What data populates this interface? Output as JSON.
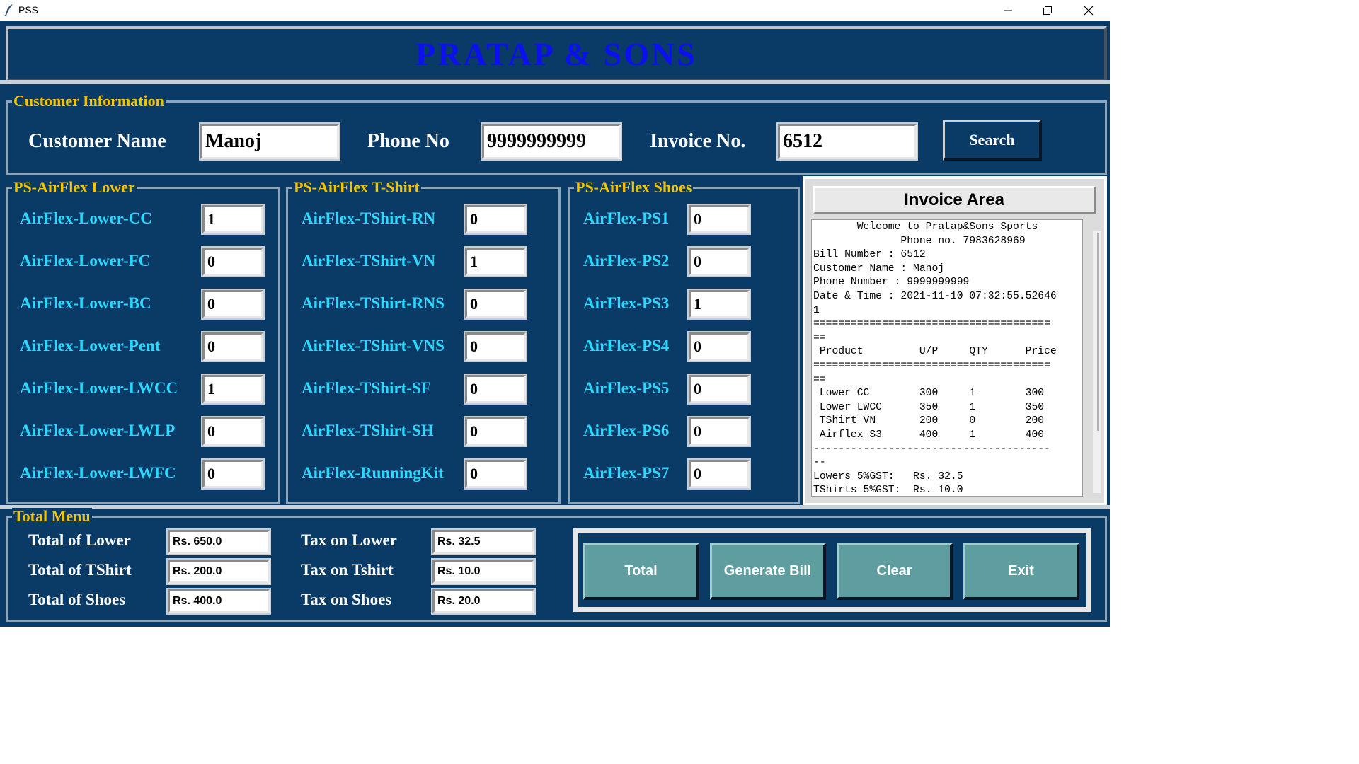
{
  "window": {
    "title": "PSS"
  },
  "header": {
    "title": "Pratap & Sons"
  },
  "customer": {
    "group_title": "Customer Information",
    "name_label": "Customer Name",
    "name_value": "Manoj",
    "phone_label": "Phone No",
    "phone_value": "9999999999",
    "invoice_label": "Invoice No.",
    "invoice_value": "6512",
    "search_label": "Search"
  },
  "lower": {
    "group_title": "PS-AirFlex Lower",
    "items": [
      {
        "label": "AirFlex-Lower-CC",
        "qty": "1"
      },
      {
        "label": "AirFlex-Lower-FC",
        "qty": "0"
      },
      {
        "label": "AirFlex-Lower-BC",
        "qty": "0"
      },
      {
        "label": "AirFlex-Lower-Pent",
        "qty": "0"
      },
      {
        "label": "AirFlex-Lower-LWCC",
        "qty": "1"
      },
      {
        "label": "AirFlex-Lower-LWLP",
        "qty": "0"
      },
      {
        "label": "AirFlex-Lower-LWFC",
        "qty": "0"
      }
    ]
  },
  "tshirt": {
    "group_title": "PS-AirFlex T-Shirt",
    "items": [
      {
        "label": "AirFlex-TShirt-RN",
        "qty": "0"
      },
      {
        "label": "AirFlex-TShirt-VN",
        "qty": "1"
      },
      {
        "label": "AirFlex-TShirt-RNS",
        "qty": "0"
      },
      {
        "label": "AirFlex-TShirt-VNS",
        "qty": "0"
      },
      {
        "label": "AirFlex-TShirt-SF",
        "qty": "0"
      },
      {
        "label": "AirFlex-TShirt-SH",
        "qty": "0"
      },
      {
        "label": "AirFlex-RunningKit",
        "qty": "0"
      }
    ]
  },
  "shoes": {
    "group_title": "PS-AirFlex Shoes",
    "items": [
      {
        "label": "AirFlex-PS1",
        "qty": "0"
      },
      {
        "label": "AirFlex-PS2",
        "qty": "0"
      },
      {
        "label": "AirFlex-PS3",
        "qty": "1"
      },
      {
        "label": "AirFlex-PS4",
        "qty": "0"
      },
      {
        "label": "AirFlex-PS5",
        "qty": "0"
      },
      {
        "label": "AirFlex-PS6",
        "qty": "0"
      },
      {
        "label": "AirFlex-PS7",
        "qty": "0"
      }
    ]
  },
  "invoice": {
    "title": "Invoice Area",
    "lines": [
      "       Welcome to Pratap&Sons Sports",
      "              Phone no. 7983628969",
      "Bill Number : 6512",
      "Customer Name : Manoj",
      "Phone Number : 9999999999",
      "Date & Time : 2021-11-10 07:32:55.52646",
      "1",
      "======================================",
      "==",
      " Product         U/P     QTY      Price",
      "======================================",
      "==",
      " Lower CC        300     1        300",
      " Lower LWCC      350     1        350",
      " TShirt VN       200     0        200",
      " Airflex S3      400     1        400",
      "--------------------------------------",
      "--",
      "Lowers 5%GST:   Rs. 32.5",
      "TShirts 5%GST:  Rs. 10.0"
    ]
  },
  "totals": {
    "group_title": "Total Menu",
    "total_lower_label": "Total of Lower",
    "total_lower_value": "Rs. 650.0",
    "total_tshirt_label": "Total of TShirt",
    "total_tshirt_value": "Rs. 200.0",
    "total_shoes_label": "Total of Shoes",
    "total_shoes_value": "Rs. 400.0",
    "tax_lower_label": "Tax on Lower",
    "tax_lower_value": "Rs. 32.5",
    "tax_tshirt_label": "Tax on Tshirt",
    "tax_tshirt_value": "Rs. 10.0",
    "tax_shoes_label": "Tax on Shoes",
    "tax_shoes_value": "Rs. 20.0"
  },
  "buttons": {
    "total": "Total",
    "generate_bill": "Generate Bill",
    "clear": "Clear",
    "exit": "Exit"
  }
}
